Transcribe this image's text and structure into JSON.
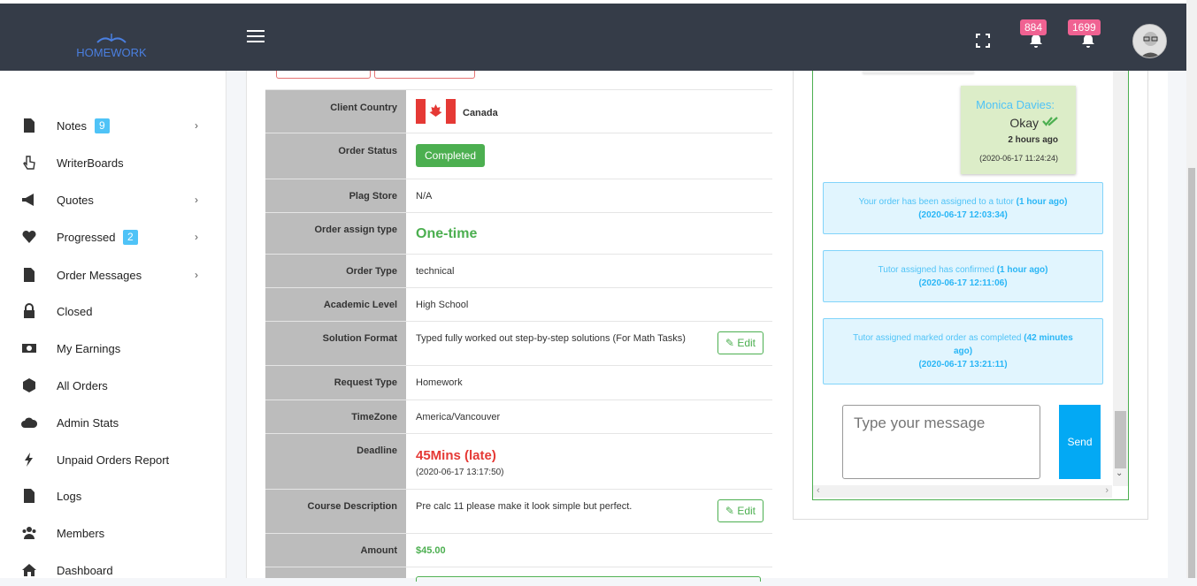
{
  "header": {
    "logo_text": "HOMEWORK",
    "notification_count_1": "884",
    "notification_count_2": "1699"
  },
  "sidebar": {
    "items": [
      {
        "label": "Notes",
        "count": "9",
        "icon": "file-icon",
        "chevron": true
      },
      {
        "label": "WriterBoards",
        "icon": "hand-pointer-icon"
      },
      {
        "label": "Quotes",
        "icon": "megaphone-icon",
        "chevron": true
      },
      {
        "label": "Progressed",
        "count": "2",
        "icon": "heart-icon",
        "chevron": true
      },
      {
        "label": "Order Messages",
        "icon": "file-icon",
        "chevron": true
      },
      {
        "label": "Closed",
        "icon": "lock-icon"
      },
      {
        "label": "My Earnings",
        "icon": "money-icon"
      },
      {
        "label": "All Orders",
        "icon": "cube-icon"
      },
      {
        "label": "Admin Stats",
        "icon": "cloud-chart-icon"
      },
      {
        "label": "Unpaid Orders Report",
        "icon": "bolt-icon"
      },
      {
        "label": "Logs",
        "icon": "file-icon"
      },
      {
        "label": "Members",
        "icon": "users-icon"
      },
      {
        "label": "Dashboard",
        "icon": "home-icon"
      }
    ]
  },
  "order": {
    "client_country_label": "Client Country",
    "client_country": "Canada",
    "order_status_label": "Order Status",
    "order_status": "Completed",
    "plag_store_label": "Plag Store",
    "plag_store": "N/A",
    "assign_type_label": "Order assign type",
    "assign_type": "One-time",
    "order_type_label": "Order Type",
    "order_type": "technical",
    "academic_level_label": "Academic Level",
    "academic_level": "High School",
    "solution_format_label": "Solution Format",
    "solution_format": "Typed fully worked out step-by-step solutions (For Math Tasks)",
    "request_type_label": "Request Type",
    "request_type": "Homework",
    "timezone_label": "TimeZone",
    "timezone": "America/Vancouver",
    "deadline_label": "Deadline",
    "deadline": "45Mins (late)",
    "deadline_date": "(2020-06-17 13:17:50)",
    "course_description_label": "Course Description",
    "course_description": "Pre calc 11 please make it look simple but perfect.",
    "amount_label": "Amount",
    "amount": "$45.00",
    "edit_label": "Edit"
  },
  "chat": {
    "green_msg": {
      "author": "Monica Davies:",
      "text": "Okay",
      "relative": "2 hours ago",
      "timestamp": "(2020-06-17 11:24:24)"
    },
    "system_msgs": [
      {
        "text": "Your order has been assigned to a tutor",
        "rel": "(1 hour ago)",
        "ts": "(2020-06-17 12:03:34)"
      },
      {
        "text": "Tutor assigned has confirmed",
        "rel": "(1 hour ago)",
        "ts": "(2020-06-17 12:11:06)"
      },
      {
        "text": "Tutor assigned marked order as completed",
        "rel": "(42 minutes ago)",
        "ts": "(2020-06-17 13:21:11)"
      }
    ],
    "input_placeholder": "Type your message",
    "send_label": "Send"
  },
  "colors": {
    "topbar": "#353c48",
    "accent_green": "#4caf50",
    "late_red": "#e53935",
    "badge_pink": "#f06292",
    "info_blue": "#03a9f4"
  }
}
